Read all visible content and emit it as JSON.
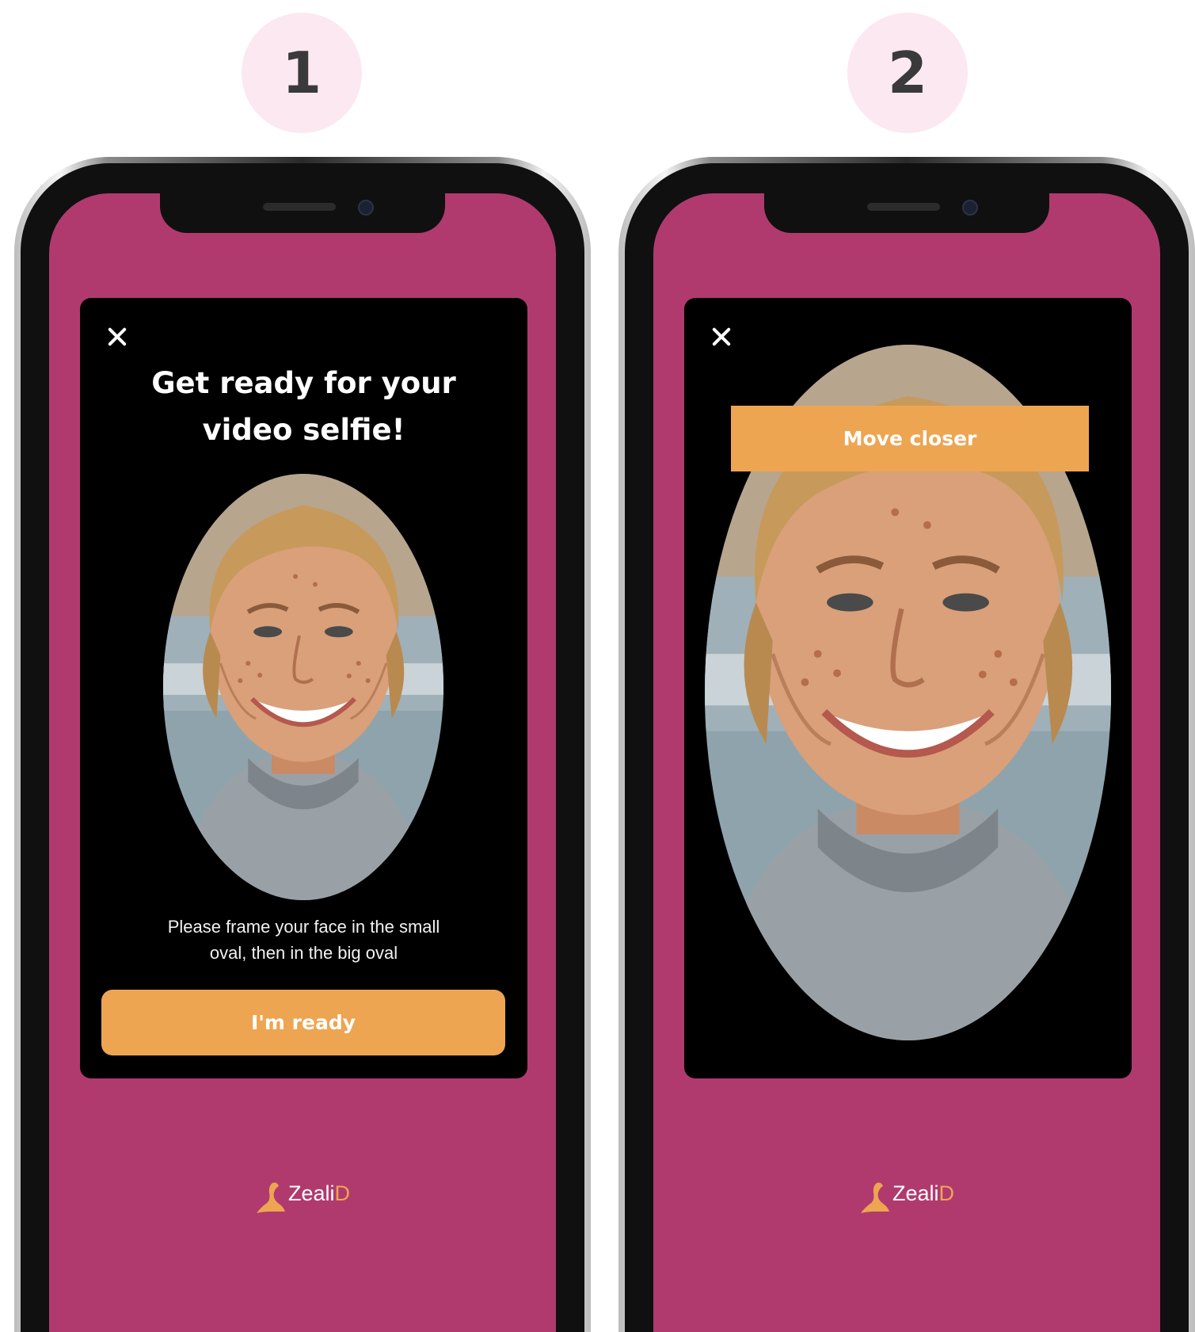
{
  "steps": [
    {
      "number": "1"
    },
    {
      "number": "2"
    }
  ],
  "screen1": {
    "title_line1": "Get ready for your",
    "title_line2": "video selfie!",
    "hint_line1": "Please frame your face in the small",
    "hint_line2": "oval, then in the big oval",
    "ready_button": "I'm ready"
  },
  "screen2": {
    "banner": "Move closer"
  },
  "logo": {
    "text_main": "Zeali",
    "text_accent": "D"
  },
  "colors": {
    "screen_background": "#b03a6e",
    "accent": "#eda552",
    "card": "#000000",
    "badge": "#fbe8f0"
  },
  "icons": {
    "close": "close-icon",
    "logo": "seal-logo-icon"
  }
}
